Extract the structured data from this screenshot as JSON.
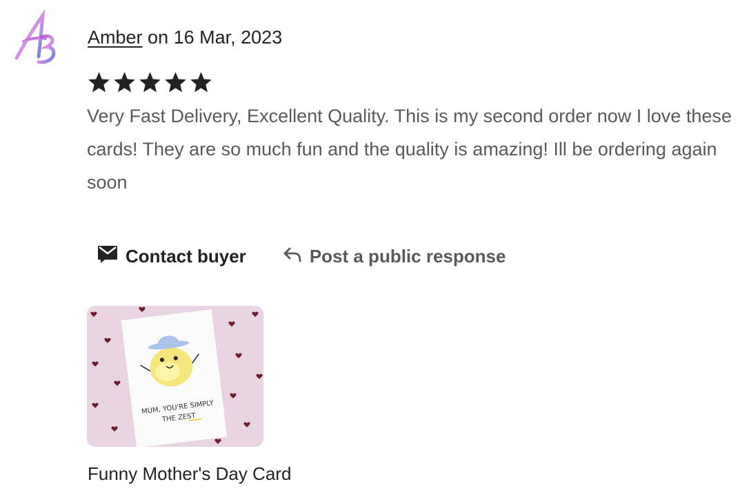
{
  "review": {
    "avatar_initials": "AB",
    "reviewer_name": "Amber",
    "date_prefix": "on",
    "date": "16 Mar, 2023",
    "rating": 5,
    "rating_max": 5,
    "text": "Very Fast Delivery, Excellent Quality. This is my second order now I love these cards! They are so much fun and the quality is amazing! Ill be ordering again soon"
  },
  "actions": {
    "contact_label": "Contact buyer",
    "contact_icon": "envelope-icon",
    "respond_label": "Post a public response",
    "respond_icon": "reply-arrow-icon"
  },
  "item": {
    "title": "Funny Mother's Day Card",
    "card_text_line1": "MUM, YOU'RE SIMPLY",
    "card_text_line2": "THE ZEST"
  },
  "colors": {
    "text_dark": "#222222",
    "text_muted": "#595959",
    "thumb_bg": "#ead3e2",
    "heart": "#6b1d2b"
  }
}
